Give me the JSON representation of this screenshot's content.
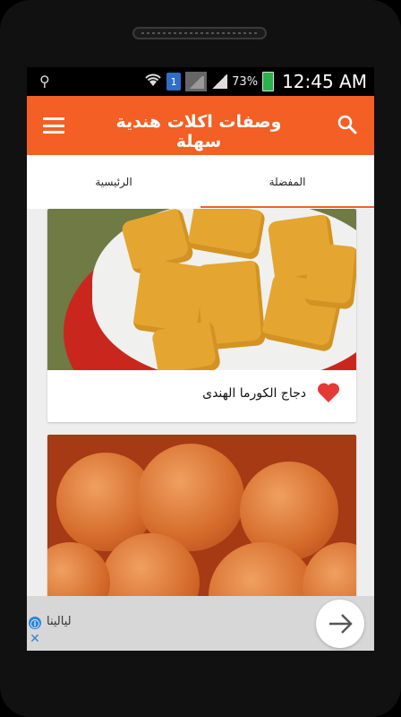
{
  "status": {
    "battery_percent": "73%",
    "time": "12:45 AM",
    "sim_label": "1"
  },
  "appbar": {
    "title": "وصفات اكلات هندية سهلة"
  },
  "tabs": {
    "favorites_label": "المفضلة",
    "home_label": "الرئيسية"
  },
  "cards": [
    {
      "title": "دجاج الكورما الهندى",
      "icon": "heart-icon"
    },
    {
      "title": ""
    }
  ],
  "ad": {
    "text": "ليالينا",
    "info_icon": "ⓘ",
    "close_icon": "✕"
  },
  "colors": {
    "accent": "#f35f24",
    "heart": "#e53935"
  }
}
